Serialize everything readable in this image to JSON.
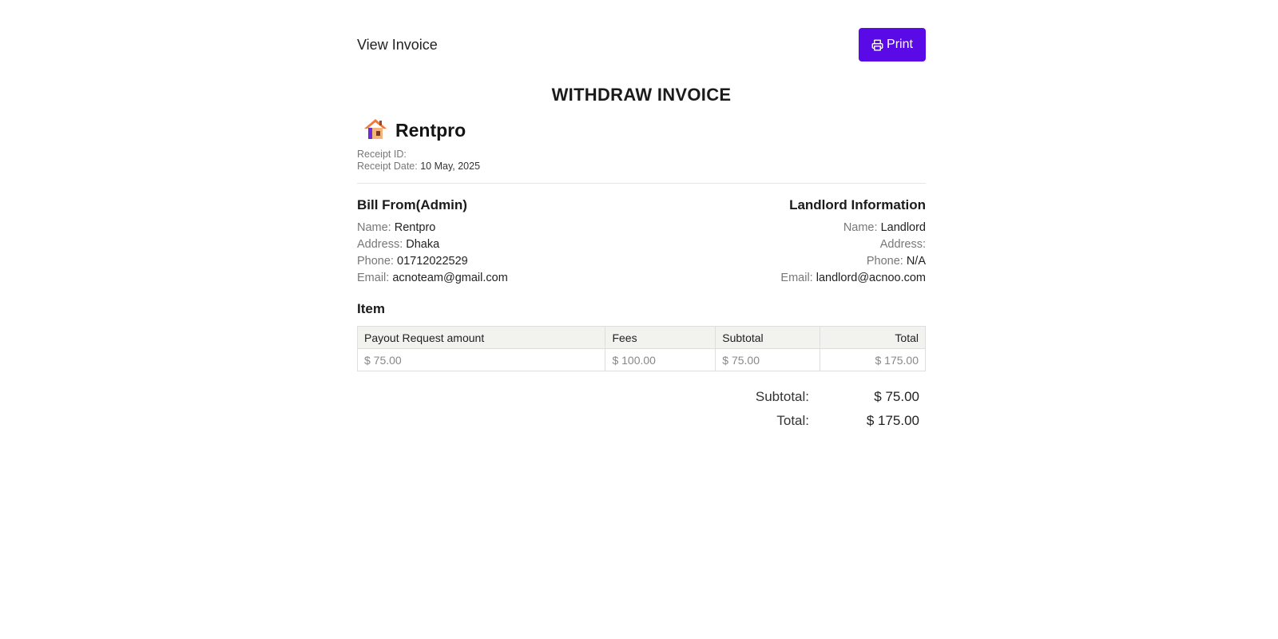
{
  "header": {
    "title": "View Invoice",
    "print_label": "Print"
  },
  "invoice": {
    "title": "WITHDRAW INVOICE",
    "brand": "Rentpro",
    "receipt_id_label": "Receipt ID:",
    "receipt_id": "",
    "receipt_date_label": "Receipt Date:",
    "receipt_date": "10 May, 2025"
  },
  "bill_from": {
    "heading": "Bill From(Admin)",
    "name_label": "Name:",
    "name": "Rentpro",
    "address_label": "Address:",
    "address": "Dhaka",
    "phone_label": "Phone:",
    "phone": "01712022529",
    "email_label": "Email:",
    "email": "acnoteam@gmail.com"
  },
  "landlord": {
    "heading": "Landlord Information",
    "name_label": "Name:",
    "name": "Landlord",
    "address_label": "Address:",
    "address": "",
    "phone_label": "Phone:",
    "phone": "N/A",
    "email_label": "Email:",
    "email": "landlord@acnoo.com"
  },
  "items": {
    "heading": "Item",
    "columns": [
      "Payout Request amount",
      "Fees",
      "Subtotal",
      "Total"
    ],
    "rows": [
      [
        "$ 75.00",
        "$ 100.00",
        "$ 75.00",
        "$ 175.00"
      ]
    ]
  },
  "totals": {
    "subtotal_label": "Subtotal:",
    "subtotal": "$ 75.00",
    "total_label": "Total:",
    "total": "$ 175.00"
  },
  "colors": {
    "accent": "#5a0ae6"
  },
  "icons": {
    "print": "printer-icon",
    "brand": "house-logo-icon"
  }
}
